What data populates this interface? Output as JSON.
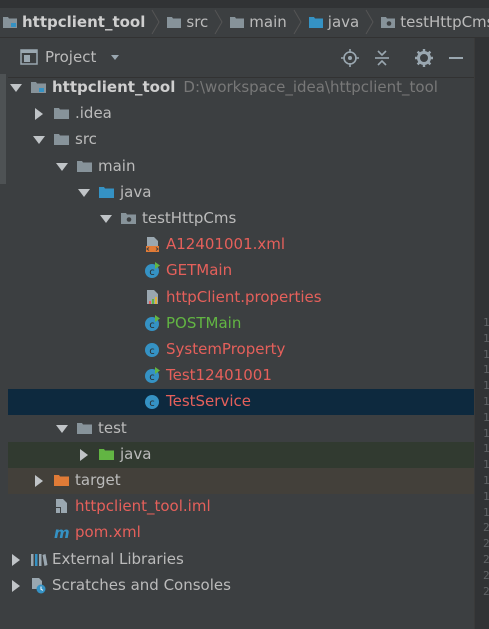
{
  "navbar": {
    "crumbs": [
      {
        "label": "httpclient_tool",
        "icon": "module-folder-icon"
      },
      {
        "label": "src",
        "icon": "folder-icon"
      },
      {
        "label": "main",
        "icon": "folder-icon"
      },
      {
        "label": "java",
        "icon": "source-folder-icon"
      },
      {
        "label": "testHttpCms",
        "icon": "package-icon"
      }
    ]
  },
  "panel": {
    "title": "Project",
    "buttons": [
      "locate-icon",
      "collapse-all-icon",
      "gear-icon",
      "hide-icon"
    ]
  },
  "tree": [
    {
      "label": "httpclient_tool",
      "sub": "D:\\workspace_idea\\httpclient_tool",
      "icon": "module-folder",
      "expanded": true,
      "style": "bold"
    },
    {
      "label": ".idea",
      "icon": "folder",
      "expanded": false,
      "style": "default"
    },
    {
      "label": "src",
      "icon": "folder",
      "expanded": true,
      "style": "default"
    },
    {
      "label": "main",
      "icon": "folder",
      "expanded": true,
      "style": "default"
    },
    {
      "label": "java",
      "icon": "source-folder",
      "expanded": true,
      "style": "default"
    },
    {
      "label": "testHttpCms",
      "icon": "package",
      "expanded": true,
      "style": "default"
    },
    {
      "label": "A12401001.xml",
      "icon": "xml-file",
      "style": "red"
    },
    {
      "label": "GETMain",
      "icon": "runnable-class",
      "style": "red"
    },
    {
      "label": "httpClient.properties",
      "icon": "properties-file",
      "style": "red"
    },
    {
      "label": "POSTMain",
      "icon": "runnable-class",
      "style": "green"
    },
    {
      "label": "SystemProperty",
      "icon": "class",
      "style": "red"
    },
    {
      "label": "Test12401001",
      "icon": "runnable-class",
      "style": "red"
    },
    {
      "label": "TestService",
      "icon": "class",
      "style": "red",
      "selected": true
    },
    {
      "label": "test",
      "icon": "folder",
      "expanded": true,
      "style": "default"
    },
    {
      "label": "java",
      "icon": "test-source-folder",
      "expanded": false,
      "style": "default"
    },
    {
      "label": "target",
      "icon": "excluded-folder",
      "expanded": false,
      "style": "default"
    },
    {
      "label": "httpclient_tool.iml",
      "icon": "iml-file",
      "style": "red"
    },
    {
      "label": "pom.xml",
      "icon": "maven-file",
      "style": "red"
    },
    {
      "label": "External Libraries",
      "icon": "libraries",
      "expanded": false,
      "style": "default"
    },
    {
      "label": "Scratches and Consoles",
      "icon": "scratches",
      "expanded": false,
      "style": "default"
    }
  ],
  "gutter": [
    "1",
    "1",
    "1",
    "1",
    "1",
    "1",
    "1",
    "1",
    "1",
    "1",
    "1",
    "1",
    "1",
    "2",
    "2",
    "2",
    "2",
    "2"
  ],
  "colors": {
    "selection": "#0d293e",
    "red": "#e5605b",
    "green": "#62b543",
    "folder": "#87939a",
    "source_folder": "#3592c4"
  }
}
